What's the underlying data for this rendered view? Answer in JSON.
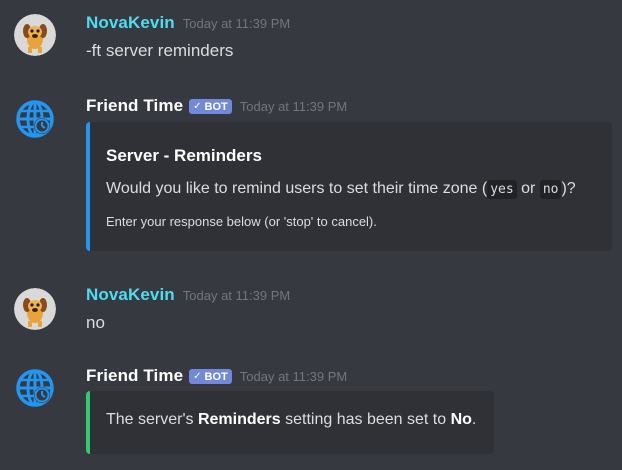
{
  "messages": [
    {
      "author": "NovaKevin",
      "timestamp": "Today at 11:39 PM",
      "text": "-ft server reminders",
      "avatar_icon": "dog-avatar-icon"
    },
    {
      "author": "Friend Time",
      "bot_tag": "BOT",
      "bot_check": "✓",
      "timestamp": "Today at 11:39 PM",
      "avatar_icon": "globe-clock-avatar-icon",
      "embed": {
        "title": "Server - Reminders",
        "desc_prefix": "Would you like to remind users to set their time zone (",
        "option_yes": "yes",
        "desc_or": " or ",
        "option_no": "no",
        "desc_suffix": ")?",
        "footer": "Enter your response below (or 'stop' to cancel).",
        "accent_color": "#2196f3"
      }
    },
    {
      "author": "NovaKevin",
      "timestamp": "Today at 11:39 PM",
      "text": "no",
      "avatar_icon": "dog-avatar-icon"
    },
    {
      "author": "Friend Time",
      "bot_tag": "BOT",
      "bot_check": "✓",
      "timestamp": "Today at 11:39 PM",
      "avatar_icon": "globe-clock-avatar-icon",
      "embed": {
        "text_prefix": "The server's ",
        "setting_name": "Reminders",
        "text_middle": " setting has been set to ",
        "setting_value": "No",
        "text_suffix": ".",
        "accent_color": "#2ecc71"
      }
    }
  ],
  "colors": {
    "background": "#36393f",
    "embed_background": "#2f3136",
    "user_name": "#4fdcf0",
    "bot_tag": "#7289da",
    "timestamp": "#72767d"
  }
}
